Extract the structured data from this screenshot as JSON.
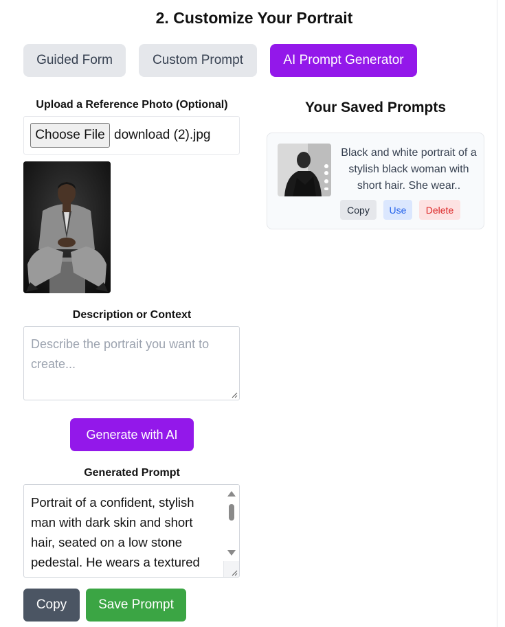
{
  "header": {
    "title": "2. Customize Your Portrait"
  },
  "tabs": [
    {
      "label": "Guided Form"
    },
    {
      "label": "Custom Prompt"
    },
    {
      "label": "AI Prompt Generator"
    }
  ],
  "upload": {
    "label": "Upload a Reference Photo (Optional)",
    "button_label": "Choose File",
    "file_name": "download (2).jpg"
  },
  "description": {
    "label": "Description or Context",
    "placeholder": "Describe the portrait you want to create..."
  },
  "generate_button": "Generate with AI",
  "generated": {
    "label": "Generated Prompt",
    "text": "Portrait of a confident, stylish man with dark skin and short hair, seated on a low stone pedestal. He wears a textured gray suit jacket and matching trousers with a patterned shirt, hands clasped in front of him against a dark background."
  },
  "actions": {
    "copy": "Copy",
    "save": "Save Prompt"
  },
  "saved": {
    "title": "Your Saved Prompts",
    "items": [
      {
        "text": "Black and white portrait of a stylish black woman with short hair. She wear..",
        "copy": "Copy",
        "use": "Use",
        "delete": "Delete"
      }
    ]
  },
  "colors": {
    "accent": "#9318ea",
    "save": "#3ba544",
    "copy": "#4b5563",
    "tab_inactive": "#e5e7eb"
  }
}
